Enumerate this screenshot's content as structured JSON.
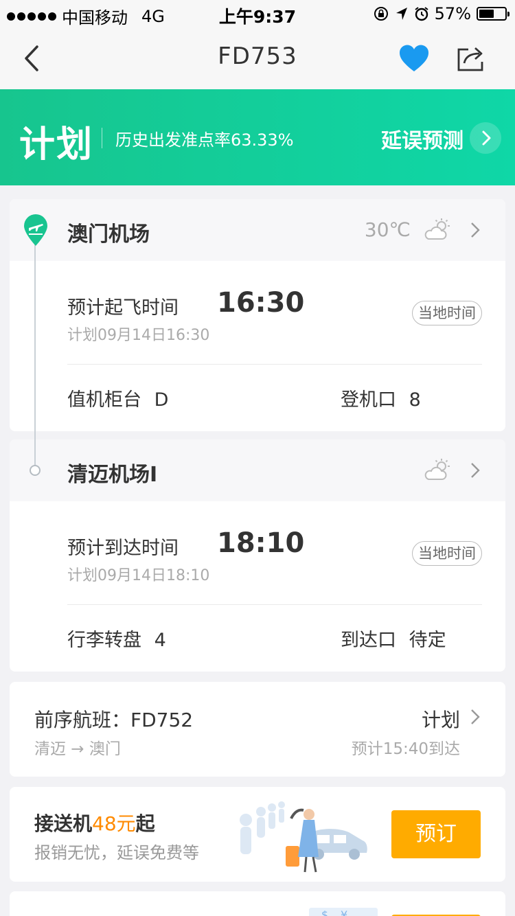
{
  "status_bar": {
    "carrier": "中国移动",
    "network": "4G",
    "time": "上午9:37",
    "battery": "57%",
    "battery_level": 0.57
  },
  "nav": {
    "title": "FD753",
    "icons": [
      "back-icon",
      "heart-icon",
      "share-icon"
    ],
    "heart_color": "#1a9af0"
  },
  "banner": {
    "status": "计划",
    "ontime_rate": "历史出发准点率63.33%",
    "predict_label": "延误预测",
    "bg_color": "#12cf9b"
  },
  "departure": {
    "airport": "澳门机场",
    "temperature": "30℃",
    "label": "预计起飞时间",
    "time": "16:30",
    "planned": "计划09月14日16:30",
    "badge": "当地时间",
    "counter_label": "值机柜台",
    "counter_value": "D",
    "gate_label": "登机口",
    "gate_value": "8"
  },
  "arrival": {
    "airport": "清迈机场I",
    "label": "预计到达时间",
    "time": "18:10",
    "planned": "计划09月14日18:10",
    "badge": "当地时间",
    "baggage_label": "行李转盘",
    "baggage_value": "4",
    "exit_label": "到达口",
    "exit_value": "待定"
  },
  "previous_flight": {
    "title": "前序航班：FD752",
    "route": "清迈 → 澳门",
    "status": "计划",
    "eta": "预计15:40到达"
  },
  "promo": {
    "title_prefix": "接送机",
    "title_price": "48元",
    "title_suffix": "起",
    "subtitle": "报销无忧，延误免费等",
    "button": "预订",
    "accent": "#ffab00"
  }
}
